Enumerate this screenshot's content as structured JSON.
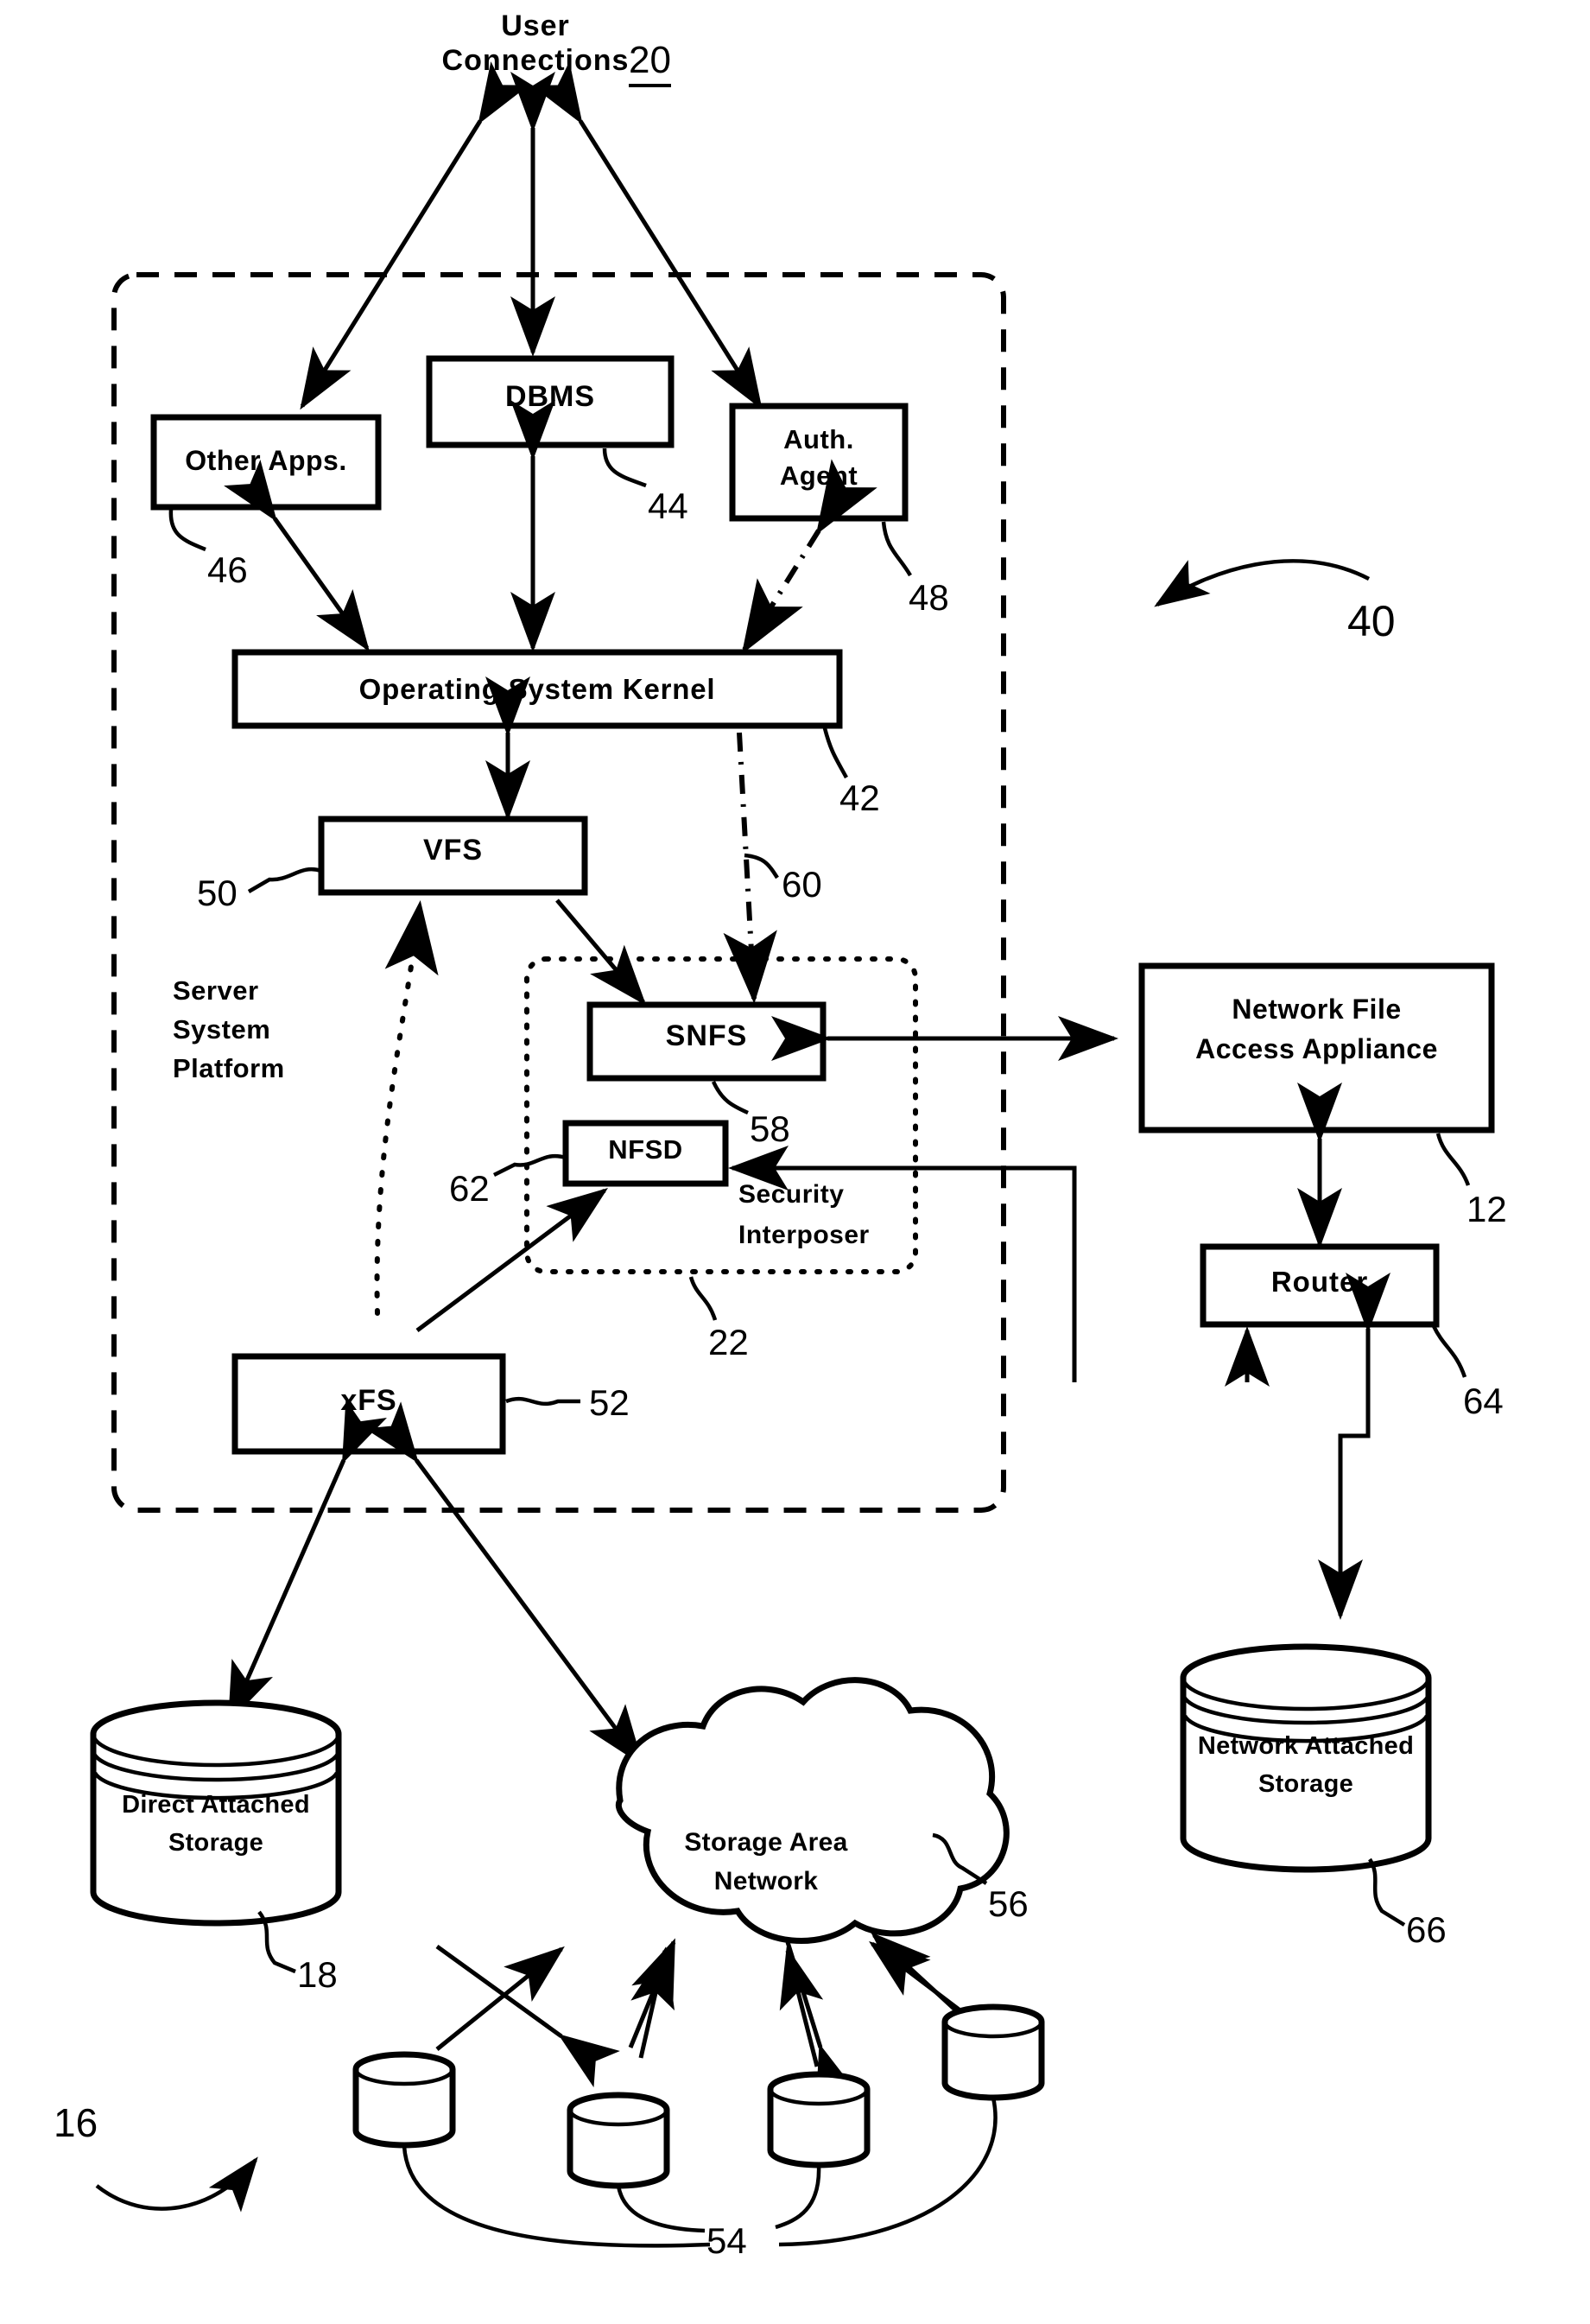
{
  "figure": {
    "title": "Server system platform with security interposer and storage fabric",
    "type": "patent-block-diagram"
  },
  "top": {
    "user_connections_line1": "User",
    "user_connections_line2": "Connections",
    "user_connections_ref": "20"
  },
  "platform": {
    "label_line1": "Server",
    "label_line2": "System",
    "label_line3": "Platform",
    "overall_ref": "40"
  },
  "blocks": {
    "other_apps": {
      "label": "Other Apps.",
      "ref": "46"
    },
    "dbms": {
      "label": "DBMS",
      "ref": "44"
    },
    "auth_agent_line1": "Auth.",
    "auth_agent_line2": "Agent",
    "auth_agent_ref": "48",
    "os_kernel": {
      "label": "Operating System Kernel",
      "ref": "42"
    },
    "vfs": {
      "label": "VFS",
      "ref": "50"
    },
    "snfs": {
      "label": "SNFS",
      "ref": "58"
    },
    "nfsd": {
      "label": "NFSD",
      "ref": "62"
    },
    "xfs": {
      "label": "xFS",
      "ref": "52"
    },
    "security_interposer_line1": "Security",
    "security_interposer_line2": "Interposer",
    "security_interposer_ref": "22",
    "kernel_interposer_link_ref": "60",
    "appliance_line1": "Network File",
    "appliance_line2": "Access Appliance",
    "appliance_ref": "12",
    "router": {
      "label": "Router",
      "ref": "64"
    }
  },
  "storage": {
    "direct_attached_line1": "Direct Attached",
    "direct_attached_line2": "Storage",
    "direct_attached_ref": "18",
    "san_line1": "Storage Area",
    "san_line2": "Network",
    "san_ref": "56",
    "san_disks_ref": "54",
    "nas_line1": "Network Attached",
    "nas_line2": "Storage",
    "nas_ref": "66",
    "fabric_ref": "16"
  },
  "colors": {
    "ink": "#000000",
    "paper": "#ffffff"
  }
}
